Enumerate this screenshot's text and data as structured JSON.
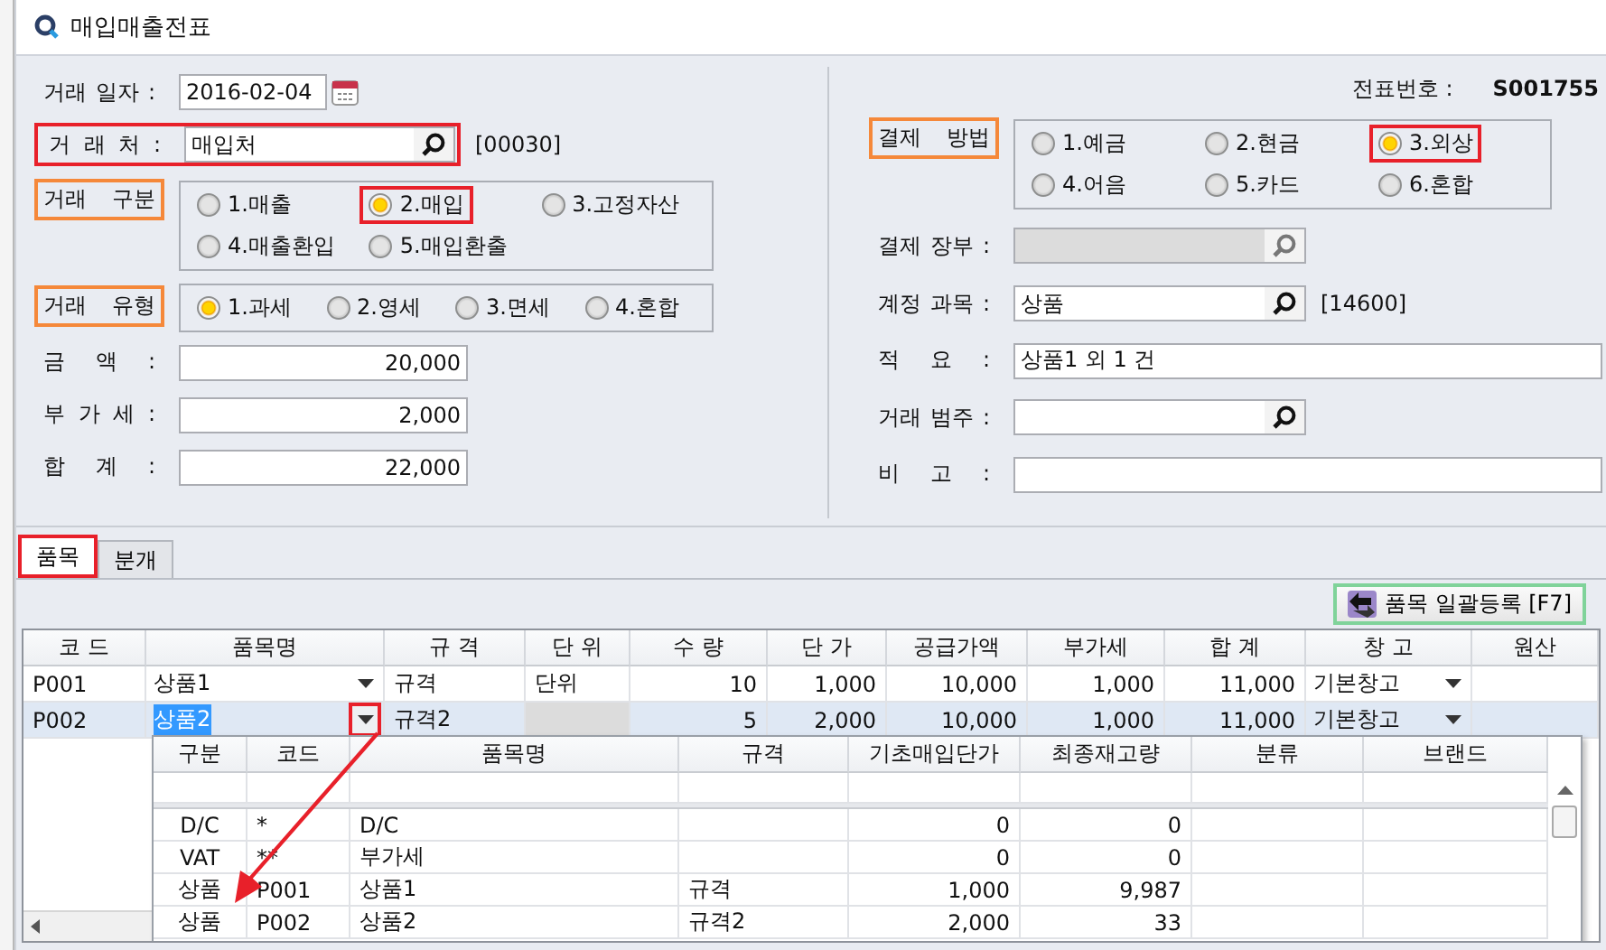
{
  "window": {
    "title": "매입매출전표"
  },
  "voucher": {
    "label": "전표번호 :",
    "value": "S001755"
  },
  "left_fields": [
    {
      "kind": "date",
      "label": "거래 일자 :",
      "value": "2016-02-04"
    },
    {
      "kind": "lookup",
      "label": "거 래 처 :",
      "value": "매입처",
      "code": "[00030]",
      "highlight": true,
      "color": "#e8202a"
    },
    {
      "kind": "radio",
      "label": "거래 구분",
      "highlight": true,
      "color": "#f5883a",
      "options": [
        {
          "label": "1.매출",
          "selected": false
        },
        {
          "label": "2.매입",
          "selected": true,
          "highlight": true,
          "color": "#e8202a"
        },
        {
          "label": "3.고정자산",
          "selected": false
        },
        {
          "label": "4.매출환입",
          "selected": false
        },
        {
          "label": "5.매입환출",
          "selected": false
        }
      ]
    },
    {
      "kind": "radio",
      "label": "거래 유형",
      "highlight": true,
      "color": "#f5883a",
      "options": [
        {
          "label": "1.과세",
          "selected": true
        },
        {
          "label": "2.영세",
          "selected": false
        },
        {
          "label": "3.면세",
          "selected": false
        },
        {
          "label": "4.혼합",
          "selected": false
        }
      ]
    },
    {
      "kind": "amount",
      "label": "금 액 :",
      "value": "20,000"
    },
    {
      "kind": "amount",
      "label": "부 가 세 :",
      "value": "2,000"
    },
    {
      "kind": "amount",
      "label": "합 계 :",
      "value": "22,000"
    }
  ],
  "right_fields": [
    {
      "kind": "radio",
      "label": "결제 방법",
      "highlight": true,
      "color": "#f5883a",
      "options": [
        {
          "label": "1.예금",
          "selected": false
        },
        {
          "label": "2.현금",
          "selected": false
        },
        {
          "label": "3.외상",
          "selected": true,
          "highlight": true,
          "color": "#e8202a"
        },
        {
          "label": "4.어음",
          "selected": false
        },
        {
          "label": "5.카드",
          "selected": false
        },
        {
          "label": "6.혼합",
          "selected": false
        }
      ]
    },
    {
      "kind": "lookup",
      "label": "결제 장부 :",
      "disabled": true
    },
    {
      "kind": "lookup",
      "label": "계정 과목 :",
      "value": "상품",
      "code": "[14600]",
      "disabled": false
    },
    {
      "kind": "text",
      "label": "적 요 :",
      "value": "상품1 외 1 건"
    },
    {
      "kind": "lookup",
      "label": "거래 범주 :",
      "disabled": false
    },
    {
      "kind": "text",
      "label": "비 고 :"
    }
  ],
  "tabs": [
    {
      "label": "품목",
      "selected": true,
      "highlight": true,
      "color": "#e8202a"
    },
    {
      "label": "분개",
      "selected": false
    }
  ],
  "bulk_button": {
    "label": "품목 일괄등록 [F7]",
    "highlight": true,
    "color": "#80d39a"
  },
  "items_table": {
    "columns": [
      "코 드",
      "품목명",
      "규 격",
      "단 위",
      "수 량",
      "단 가",
      "공급가액",
      "부가세",
      "합 계",
      "창 고",
      "원산"
    ],
    "rows": [
      {
        "selected": false,
        "cells": [
          {
            "kind": "text",
            "text": "P001"
          },
          {
            "kind": "combo",
            "text": "상품1"
          },
          {
            "kind": "text",
            "text": "규격"
          },
          {
            "kind": "text",
            "text": "단위"
          },
          {
            "kind": "text",
            "text": "10"
          },
          {
            "kind": "text",
            "text": "1,000"
          },
          {
            "kind": "text",
            "text": "10,000"
          },
          {
            "kind": "text",
            "text": "1,000"
          },
          {
            "kind": "text",
            "text": "11,000"
          },
          {
            "kind": "combo",
            "text": "기본창고"
          },
          {
            "kind": "empty"
          }
        ]
      },
      {
        "selected": true,
        "cells": [
          {
            "kind": "text",
            "text": "P002"
          },
          {
            "kind": "editing",
            "text": "상품2",
            "highlight": true,
            "color": "#e8202a"
          },
          {
            "kind": "text",
            "text": "규격2"
          },
          {
            "kind": "disabled"
          },
          {
            "kind": "text",
            "text": "5"
          },
          {
            "kind": "text",
            "text": "2,000"
          },
          {
            "kind": "text",
            "text": "10,000"
          },
          {
            "kind": "text",
            "text": "1,000"
          },
          {
            "kind": "text",
            "text": "11,000"
          },
          {
            "kind": "combo",
            "text": "기본창고"
          },
          {
            "kind": "empty"
          }
        ]
      }
    ]
  },
  "item_dropdown": {
    "columns": [
      "구분",
      "코드",
      "품목명",
      "규격",
      "기초매입단가",
      "최종재고량",
      "분류",
      "브랜드"
    ],
    "rows": [
      [
        "D/C",
        "*",
        "D/C",
        null,
        "0",
        "0",
        null,
        null
      ],
      [
        "VAT",
        "**",
        "부가세",
        null,
        "0",
        "0",
        null,
        null
      ],
      [
        "상품",
        "P001",
        "상품1",
        "규격",
        "1,000",
        "9,987",
        null,
        null
      ],
      [
        "상품",
        "P002",
        "상품2",
        "규격2",
        "2,000",
        "33",
        null,
        null
      ]
    ]
  }
}
